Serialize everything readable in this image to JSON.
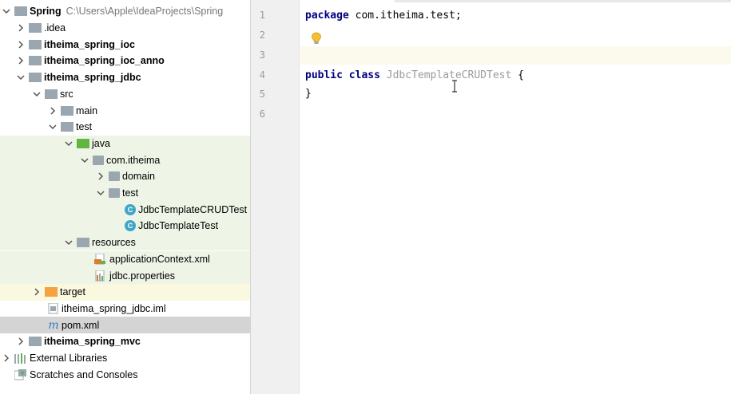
{
  "project_tree": {
    "rows": [
      {
        "label": "Spring",
        "path": "C:\\Users\\Apple\\IdeaProjects\\Spring",
        "bold": true,
        "icon": "module-folder-icon",
        "arrow": "down"
      },
      {
        "label": ".idea",
        "icon": "folder-icon",
        "arrow": "right"
      },
      {
        "label": "itheima_spring_ioc",
        "bold": true,
        "icon": "module-folder-icon",
        "arrow": "right"
      },
      {
        "label": "itheima_spring_ioc_anno",
        "bold": true,
        "icon": "module-folder-icon",
        "arrow": "right"
      },
      {
        "label": "itheima_spring_jdbc",
        "bold": true,
        "icon": "module-folder-icon",
        "arrow": "down"
      },
      {
        "label": "src",
        "icon": "folder-icon",
        "arrow": "down"
      },
      {
        "label": "main",
        "icon": "folder-icon",
        "arrow": "right"
      },
      {
        "label": "test",
        "icon": "folder-icon",
        "arrow": "down"
      },
      {
        "label": "java",
        "icon": "test-source-folder-icon",
        "arrow": "down"
      },
      {
        "label": "com.itheima",
        "icon": "package-icon",
        "arrow": "down"
      },
      {
        "label": "domain",
        "icon": "package-icon",
        "arrow": "right"
      },
      {
        "label": "test",
        "icon": "package-icon",
        "arrow": "down"
      },
      {
        "label": "JdbcTemplateCRUDTest",
        "icon": "java-class-icon"
      },
      {
        "label": "JdbcTemplateTest",
        "icon": "java-class-icon"
      },
      {
        "label": "resources",
        "icon": "resources-folder-icon",
        "arrow": "down"
      },
      {
        "label": "applicationContext.xml",
        "icon": "xml-file-icon"
      },
      {
        "label": "jdbc.properties",
        "icon": "properties-file-icon"
      },
      {
        "label": "target",
        "icon": "excluded-folder-icon",
        "arrow": "right"
      },
      {
        "label": "itheima_spring_jdbc.iml",
        "icon": "iml-file-icon"
      },
      {
        "label": "pom.xml",
        "icon": "maven-file-icon"
      },
      {
        "label": "itheima_spring_mvc",
        "bold": true,
        "icon": "module-folder-icon",
        "arrow": "right"
      },
      {
        "label": "External Libraries",
        "icon": "libraries-icon",
        "arrow": "right"
      },
      {
        "label": "Scratches and Consoles",
        "icon": "scratches-icon"
      }
    ]
  },
  "editor": {
    "line_numbers": [
      "1",
      "2",
      "3",
      "4",
      "5",
      "6"
    ],
    "line1": {
      "kw": "package",
      "rest": " com.itheima.test;"
    },
    "line4": {
      "kw1": "public",
      "kw2": "class",
      "cls": "JdbcTemplateCRUDTest",
      "brace": " {"
    },
    "line5": "}"
  },
  "colors": {
    "keyword": "#000080",
    "unused_class_name": "#9b9b9b",
    "test_tint": "#eef4e6",
    "excluded_tint": "#fbf8e0",
    "selection": "#d4d4d4"
  }
}
